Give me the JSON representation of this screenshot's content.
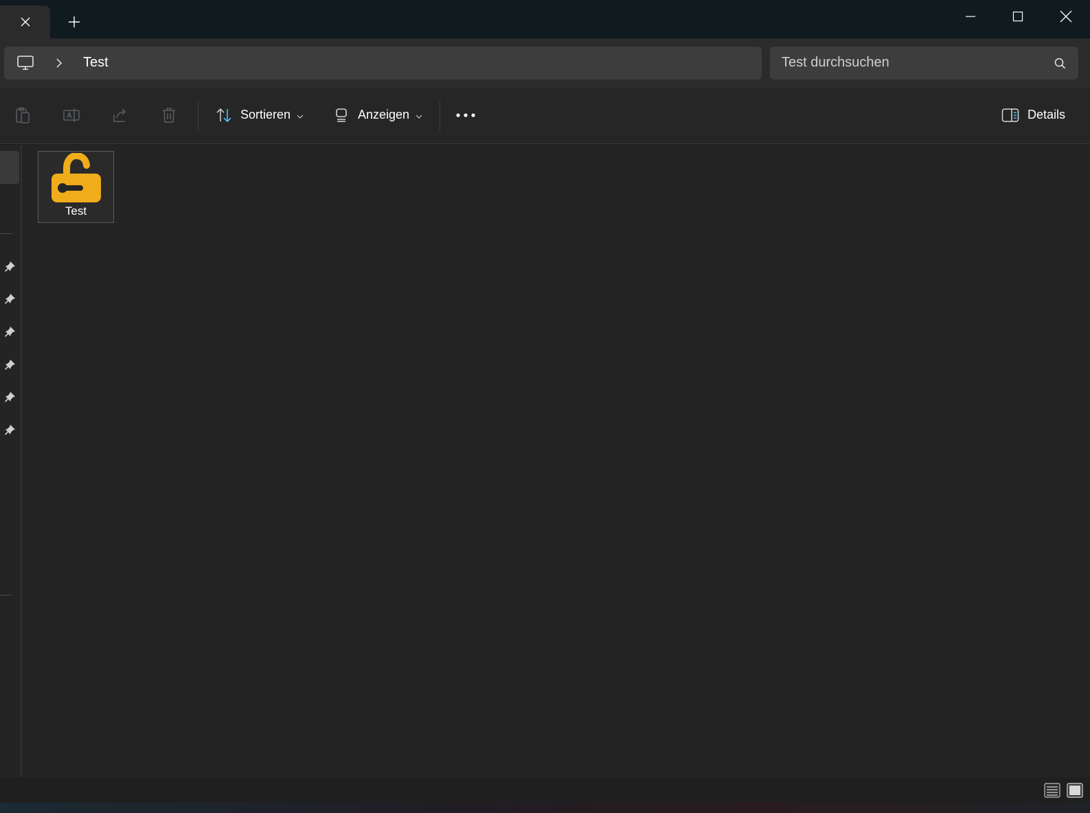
{
  "window": {
    "tab_close_icon": "close-icon",
    "new_tab_icon": "plus-icon",
    "controls": [
      "minimize-icon",
      "maximize-icon",
      "close-icon"
    ]
  },
  "address": {
    "root_icon": "this-pc-icon",
    "separator_icon": "chevron-right-icon",
    "current_folder": "Test"
  },
  "search": {
    "placeholder": "Test durchsuchen",
    "icon": "search-icon"
  },
  "toolbar": {
    "disabled_actions": [
      "paste-icon",
      "rename-icon",
      "share-icon",
      "delete-icon"
    ],
    "sort_label": "Sortieren",
    "view_label": "Anzeigen",
    "more_icon": "more-icon",
    "details_label": "Details"
  },
  "files": [
    {
      "name": "Test",
      "icon": "unlocked-lock-icon",
      "icon_color": "#f0ac1b"
    }
  ],
  "nav": {
    "pinned_count": 6
  },
  "colors": {
    "accent": "#4cc2ff",
    "lock": "#f0ac1b"
  }
}
